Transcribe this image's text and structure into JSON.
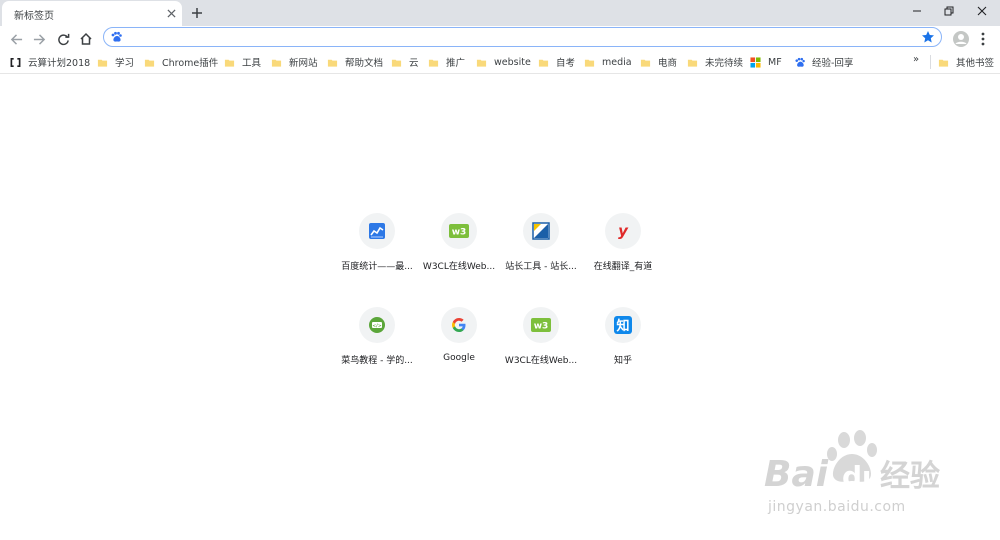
{
  "tab": {
    "title": "新标签页"
  },
  "omnibox": {
    "value": "",
    "placeholder": ""
  },
  "bookmarks": {
    "items": [
      {
        "label": "云算计划2018",
        "icon": "cloud-code-icon"
      },
      {
        "label": "学习",
        "icon": "folder-icon"
      },
      {
        "label": "Chrome插件",
        "icon": "folder-icon"
      },
      {
        "label": "工具",
        "icon": "folder-icon"
      },
      {
        "label": "新网站",
        "icon": "folder-icon"
      },
      {
        "label": "帮助文档",
        "icon": "folder-icon"
      },
      {
        "label": "云",
        "icon": "folder-icon"
      },
      {
        "label": "推广",
        "icon": "folder-icon"
      },
      {
        "label": "website",
        "icon": "folder-icon"
      },
      {
        "label": "自考",
        "icon": "folder-icon"
      },
      {
        "label": "media",
        "icon": "folder-icon"
      },
      {
        "label": "电商",
        "icon": "folder-icon"
      },
      {
        "label": "未完待续",
        "icon": "folder-icon"
      },
      {
        "label": "MF",
        "icon": "microsoft-icon"
      },
      {
        "label": "经验-回享",
        "icon": "baidu-paw-icon"
      }
    ],
    "more": "»",
    "other": "其他书签"
  },
  "tiles": [
    {
      "label": "百度统计——最...",
      "icon": "baidu-tongji-icon"
    },
    {
      "label": "W3CL在线Web...",
      "icon": "w3c-icon"
    },
    {
      "label": "站长工具 - 站长...",
      "icon": "chinaz-icon"
    },
    {
      "label": "在线翻译_有道",
      "icon": "youdao-icon"
    },
    {
      "label": "菜鸟教程 - 学的...",
      "icon": "runoob-icon"
    },
    {
      "label": "Google",
      "icon": "google-icon"
    },
    {
      "label": "W3CL在线Web...",
      "icon": "w3c-icon"
    },
    {
      "label": "知乎",
      "icon": "zhihu-icon"
    }
  ],
  "watermark": {
    "brand": "Bai",
    "brand2": "du",
    "cn": "经验",
    "url": "jingyan.baidu.com"
  },
  "colors": {
    "accent": "#1a73e8",
    "omnibox_border": "#8ab4f8",
    "tabstrip": "#dee1e6",
    "folder": "#f9d97a"
  }
}
